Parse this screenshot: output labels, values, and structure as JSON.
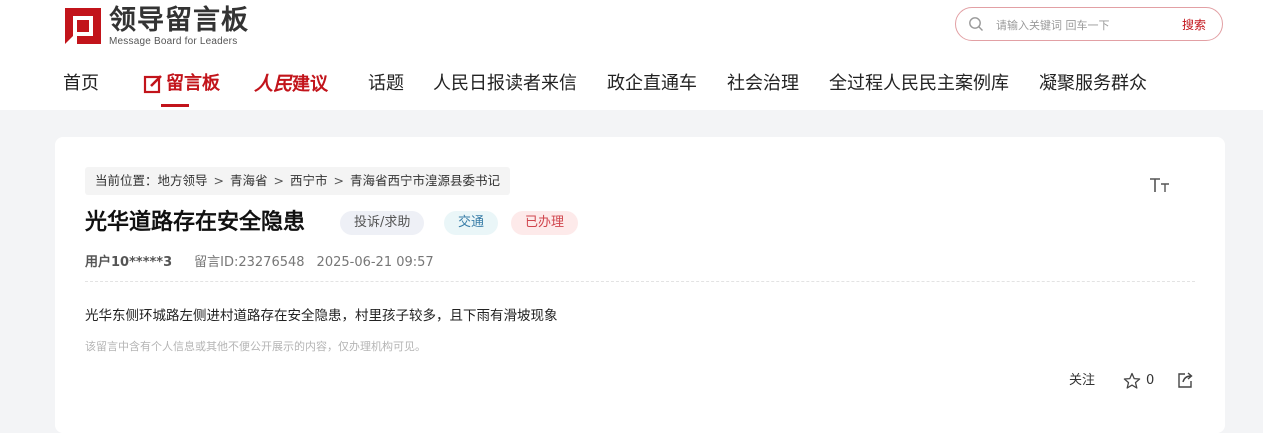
{
  "header": {
    "logo_title": "领导留言板",
    "logo_subtitle": "Message Board for Leaders",
    "search": {
      "placeholder": "请输入关键词 回车一下",
      "button_label": "搜索"
    }
  },
  "nav": {
    "items": [
      {
        "label": "首页"
      },
      {
        "label": "留言板"
      },
      {
        "label_a": "人民",
        "label_b": "建议"
      },
      {
        "label": "话题"
      },
      {
        "label": "人民日报读者来信"
      },
      {
        "label": "政企直通车"
      },
      {
        "label": "社会治理"
      },
      {
        "label": "全过程人民民主案例库"
      },
      {
        "label": "凝聚服务群众"
      }
    ]
  },
  "breadcrumb": {
    "prefix": "当前位置：",
    "items": [
      "地方领导",
      "青海省",
      "西宁市",
      "青海省西宁市湟源县委书记"
    ],
    "separator": ">"
  },
  "message": {
    "title": "光华道路存在安全隐患",
    "tags": {
      "type": "投诉/求助",
      "field": "交通",
      "status": "已办理"
    },
    "user": "用户10*****3",
    "message_id": "留言ID:23276548",
    "datetime": "2025-06-21 09:57",
    "content": "光华东侧环城路左侧进村道路存在安全隐患，村里孩子较多，且下雨有滑坡现象",
    "privacy_notice": "该留言中含有个人信息或其他不便公开展示的内容，仅办理机构可见。"
  },
  "actions": {
    "follow_label": "关注",
    "star_count": "0"
  },
  "colors": {
    "brand_red": "#c2141b",
    "page_bg": "#f3f4f6"
  },
  "icons": [
    "logo-icon",
    "search-icon",
    "edit-icon",
    "font-size-icon",
    "star-icon",
    "share-icon"
  ]
}
